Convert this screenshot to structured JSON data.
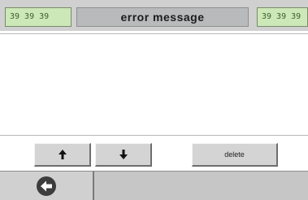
{
  "header": {
    "left_time": "39 39 39",
    "title": "error message",
    "right_time": "39 39 39"
  },
  "buttons": {
    "up_icon": "arrow-up-icon",
    "down_icon": "arrow-down-icon",
    "delete_label": "delete"
  },
  "footer": {
    "back_icon": "back-arrow-circle-icon"
  },
  "colors": {
    "lcd_background": "#cde8b8",
    "lcd_text": "#3a5f2a",
    "title_background": "#b9babb",
    "button_face": "#d4d4d4"
  }
}
